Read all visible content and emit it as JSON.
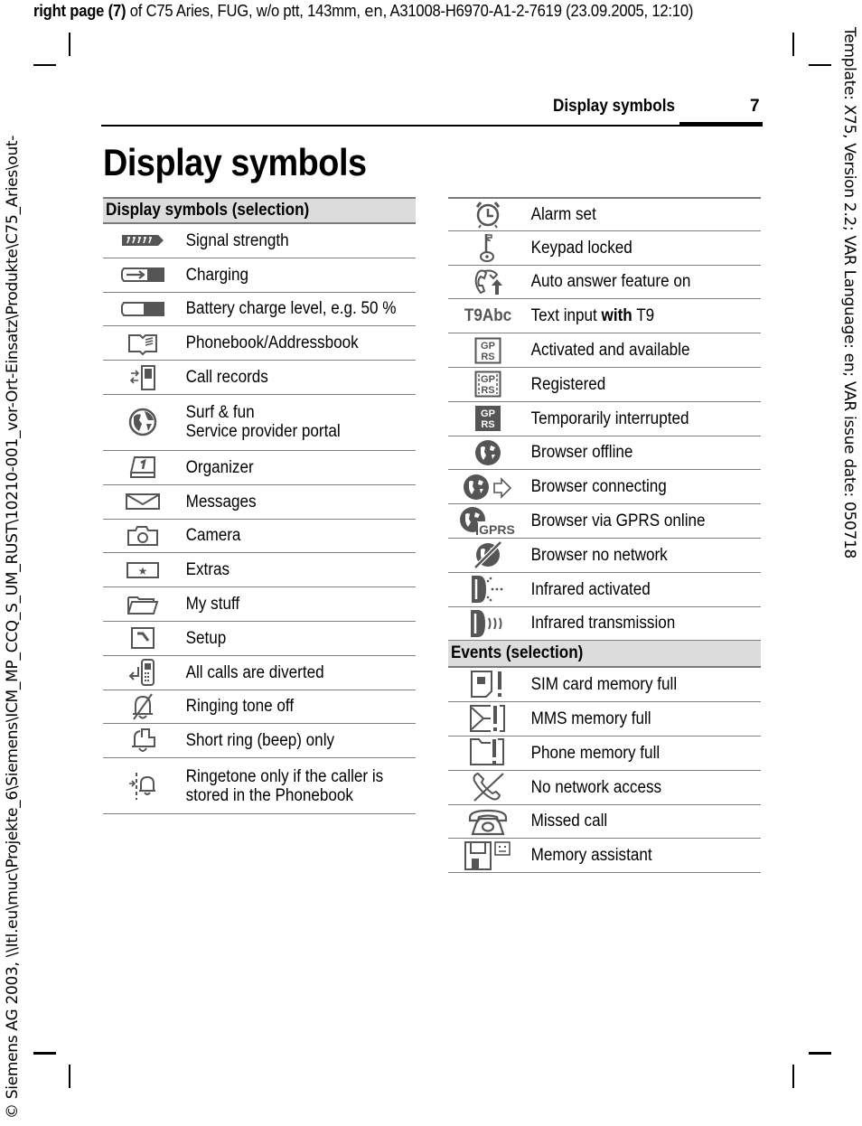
{
  "print_meta": {
    "bold_part": "right page (7)",
    "rest_pre": " of C75 Aries, FUG,  w/o ptt, 143mm, ",
    "lang": "en",
    "rest_post": ", A31008-H6970-A1-2-7619 (23.09.2005, 12:10)"
  },
  "side_left": "© Siemens AG 2003, \\\\Itl.eu\\muc\\Projekte_6\\Siemens\\ICM_MP_CCQ_S_UM_RUST\\10210-001_vor-Ort-Einsatz\\Produkte\\C75_Aries\\out-",
  "side_right": "Template: X75, Version 2.2; VAR Language: en; VAR issue date: 050718",
  "running_head": "Display symbols",
  "page_number": "7",
  "page_title": "Display symbols",
  "left_table": {
    "header": "Display symbols (selection)",
    "rows": [
      {
        "icon": "signal-strength-icon",
        "label": "Signal strength"
      },
      {
        "icon": "charging-icon",
        "label": "Charging"
      },
      {
        "icon": "battery-icon",
        "label": "Battery charge level, e.g. 50 %"
      },
      {
        "icon": "phonebook-icon",
        "label": "Phonebook/Addressbook"
      },
      {
        "icon": "call-records-icon",
        "label": "Call records"
      },
      {
        "icon": "globe-icon",
        "label": "Surf & fun",
        "label2": "Service provider portal"
      },
      {
        "icon": "organizer-icon",
        "label": "Organizer"
      },
      {
        "icon": "messages-icon",
        "label": "Messages"
      },
      {
        "icon": "camera-icon",
        "label": "Camera"
      },
      {
        "icon": "extras-icon",
        "label": "Extras"
      },
      {
        "icon": "folder-icon",
        "label": "My stuff"
      },
      {
        "icon": "setup-icon",
        "label": "Setup"
      },
      {
        "icon": "call-divert-icon",
        "label": "All calls are diverted"
      },
      {
        "icon": "ringer-off-icon",
        "label": "Ringing tone off"
      },
      {
        "icon": "beep-icon",
        "label": "Short ring (beep) only"
      },
      {
        "icon": "phonebook-ring-icon",
        "label": "Ringetone only if the caller is",
        "label2": "stored in the Phonebook"
      }
    ]
  },
  "right_table": {
    "rows": [
      {
        "icon": "alarm-icon",
        "label": "Alarm set"
      },
      {
        "icon": "key-icon",
        "label": "Keypad locked"
      },
      {
        "icon": "auto-answer-icon",
        "label": "Auto answer feature on"
      },
      {
        "icon": "t9-icon",
        "icon_text": "T9Abc",
        "label_pre": "Text input ",
        "label_bold": "with",
        "label_post": " T9"
      },
      {
        "icon": "gprs-active-icon",
        "icon_text1": "GP",
        "icon_text2": "RS",
        "label": "Activated and available"
      },
      {
        "icon": "gprs-registered-icon",
        "icon_text1": "GP",
        "icon_text2": "RS",
        "label": "Registered"
      },
      {
        "icon": "gprs-interrupted-icon",
        "icon_text1": "GP",
        "icon_text2": "RS",
        "label": "Temporarily interrupted"
      },
      {
        "icon": "browser-offline-icon",
        "label": "Browser offline"
      },
      {
        "icon": "browser-connecting-icon",
        "label": "Browser connecting"
      },
      {
        "icon": "browser-gprs-icon",
        "icon_text": "GPRS",
        "label": "Browser via GPRS online"
      },
      {
        "icon": "browser-no-network-icon",
        "label": "Browser no network"
      },
      {
        "icon": "infrared-activated-icon",
        "label": "Infrared activated"
      },
      {
        "icon": "infrared-transmission-icon",
        "label": "Infrared transmission"
      }
    ],
    "events_header": "Events (selection)",
    "events": [
      {
        "icon": "sim-full-icon",
        "label": "SIM card memory full"
      },
      {
        "icon": "mms-full-icon",
        "label": "MMS memory full"
      },
      {
        "icon": "phone-memory-full-icon",
        "label": "Phone memory full"
      },
      {
        "icon": "no-network-icon",
        "label": "No network access"
      },
      {
        "icon": "missed-call-icon",
        "label": "Missed call"
      },
      {
        "icon": "memory-assistant-icon",
        "label": "Memory assistant"
      }
    ]
  },
  "colors": {
    "icon_gray": "#555555",
    "header_bg": "#dcdcdc",
    "rule": "#808080"
  }
}
